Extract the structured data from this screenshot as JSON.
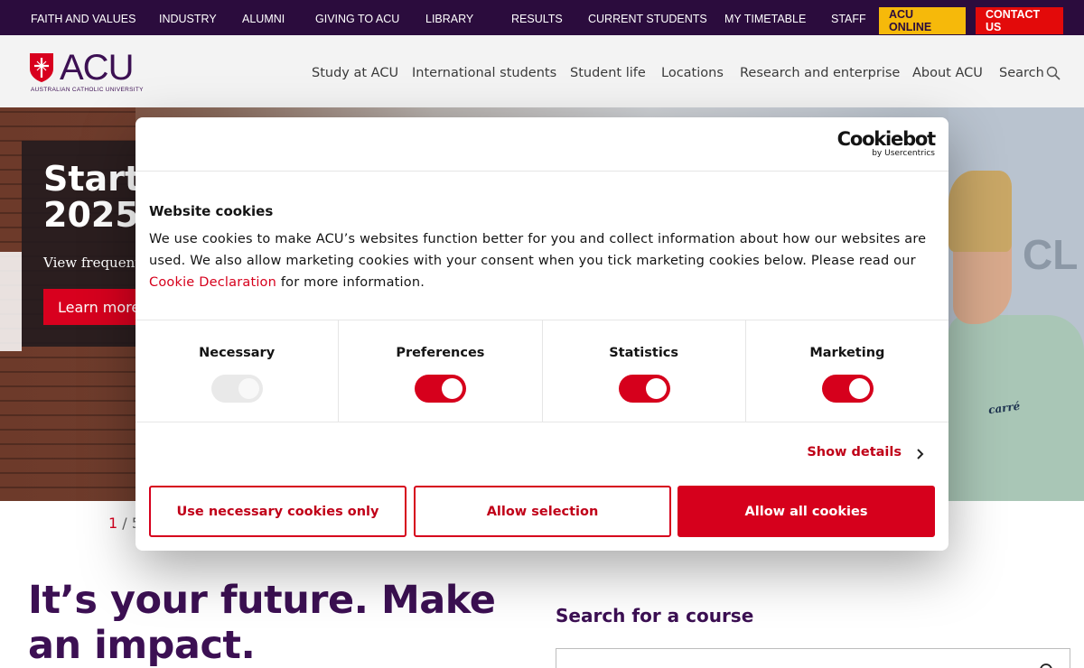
{
  "topbar": {
    "links": [
      "FAITH AND VALUES",
      "INDUSTRY",
      "ALUMNI",
      "GIVING TO ACU",
      "LIBRARY",
      "RESULTS",
      "CURRENT STUDENTS",
      "MY TIMETABLE",
      "STAFF"
    ],
    "acu_online": "ACU ONLINE",
    "contact_us": "CONTACT US"
  },
  "header": {
    "logo_text": "ACU",
    "logo_subtitle": "AUSTRALIAN CATHOLIC UNIVERSITY",
    "nav": [
      "Study at ACU",
      "International students",
      "Student life",
      "Locations",
      "Research and enterprise",
      "About ACU",
      "Search"
    ]
  },
  "hero": {
    "title": "Start\n2025",
    "subtitle": "View frequentl",
    "button": "Learn more",
    "sign_text": "CL",
    "hoodie_text": "carré",
    "pager_current": "1",
    "pager_total": " / 5"
  },
  "main": {
    "tagline": "It’s your future. Make an impact.",
    "search_heading": "Search for a course"
  },
  "cookie": {
    "brand": "Cookiebot",
    "brand_by": "by Usercentrics",
    "title": "Website cookies",
    "body_before": "We use cookies to make ACU’s websites function better for you and collect information about how our websites are used. We also allow marketing cookies with your consent when you tick marketing cookies below. Please read our ",
    "body_link": "Cookie Declaration",
    "body_after": " for more information.",
    "categories": [
      {
        "label": "Necessary",
        "enabled": true,
        "locked": true
      },
      {
        "label": "Preferences",
        "enabled": true,
        "locked": false
      },
      {
        "label": "Statistics",
        "enabled": true,
        "locked": false
      },
      {
        "label": "Marketing",
        "enabled": true,
        "locked": false
      }
    ],
    "show_details": "Show details",
    "btn_necessary": "Use necessary cookies only",
    "btn_selection": "Allow selection",
    "btn_all": "Allow all cookies"
  },
  "colors": {
    "topbar": "#2b0c3d",
    "brand_purple": "#3c1053",
    "accent_red": "#d6001c",
    "acu_online": "#f6b90a"
  }
}
